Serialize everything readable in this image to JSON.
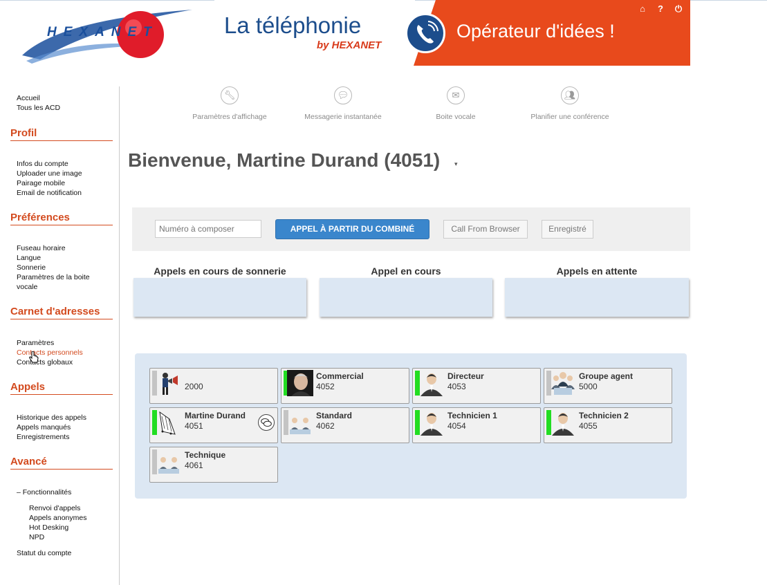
{
  "header": {
    "logo_text": "HEXANET",
    "banner_title": "La téléphonie",
    "banner_by": "by HEXANET",
    "banner_slogan": "Opérateur d'idées !",
    "icons": [
      "home-icon",
      "help-icon",
      "power-icon"
    ]
  },
  "sidebar": {
    "top_links": [
      "Accueil",
      "Tous les ACD"
    ],
    "sections": [
      {
        "title": "Profil",
        "items": [
          "Infos du compte",
          "Uploader une image",
          "Pairage mobile",
          "Email de notification"
        ]
      },
      {
        "title": "Préférences",
        "items": [
          "Fuseau horaire",
          "Langue",
          "Sonnerie",
          "Paramètres de la boite",
          "vocale"
        ]
      },
      {
        "title": "Carnet d'adresses",
        "items": [
          "Paramètres",
          "Contacts personnels",
          "Contacts globaux"
        ]
      },
      {
        "title": "Appels",
        "items": [
          "Historique des appels",
          "Appels manqués",
          "Enregistrements"
        ]
      },
      {
        "title": "Avancé",
        "items": [
          "– Fonctionnalités"
        ]
      }
    ],
    "advanced_sub": [
      "Renvoi d'appels",
      "Appels anonymes",
      "Hot Desking",
      "NPD"
    ],
    "bottom_link": "Statut du compte",
    "active_item": "Contacts personnels"
  },
  "toolbar": {
    "items": [
      {
        "label": "Paramètres d'affichage",
        "icon": "wrench-icon"
      },
      {
        "label": "Messagerie instantanée",
        "icon": "chat-icon"
      },
      {
        "label": "Boite vocale",
        "icon": "envelope-icon"
      },
      {
        "label": "Planifier une conférence",
        "icon": "group-icon"
      }
    ]
  },
  "welcome": "Bienvenue, Martine Durand (4051)",
  "dial": {
    "placeholder": "Numéro à composer",
    "primary_label": "APPEL À PARTIR DU COMBINÉ",
    "browser_label": "Call From Browser",
    "record_label": "Enregistré"
  },
  "panels": [
    "Appels en cours de sonnerie",
    "Appel en cours",
    "Appels en attente"
  ],
  "contacts": [
    {
      "name": "",
      "ext": "2000",
      "status": "gray",
      "avatar": "speaker-icon"
    },
    {
      "name": "Commercial",
      "ext": "4052",
      "status": "green",
      "avatar": "photo-avatar"
    },
    {
      "name": "Directeur",
      "ext": "4053",
      "status": "green",
      "avatar": "person-icon"
    },
    {
      "name": "Groupe agent",
      "ext": "5000",
      "status": "gray",
      "avatar": "group-agent-icon"
    },
    {
      "name": "Martine Durand",
      "ext": "4051",
      "status": "green",
      "avatar": "sketch-avatar",
      "chat": true
    },
    {
      "name": "Standard",
      "ext": "4062",
      "status": "gray",
      "avatar": "pair-icon"
    },
    {
      "name": "Technicien 1",
      "ext": "4054",
      "status": "green",
      "avatar": "person-icon"
    },
    {
      "name": "Technicien 2",
      "ext": "4055",
      "status": "green",
      "avatar": "person-icon"
    },
    {
      "name": "Technique",
      "ext": "4061",
      "status": "gray",
      "avatar": "pair-icon"
    }
  ],
  "colors": {
    "accent": "#d34a1e",
    "primary_button": "#3a86cc",
    "status_green": "#22dd22",
    "status_gray": "#c4c4c4",
    "panel_bg": "#dce7f3"
  }
}
